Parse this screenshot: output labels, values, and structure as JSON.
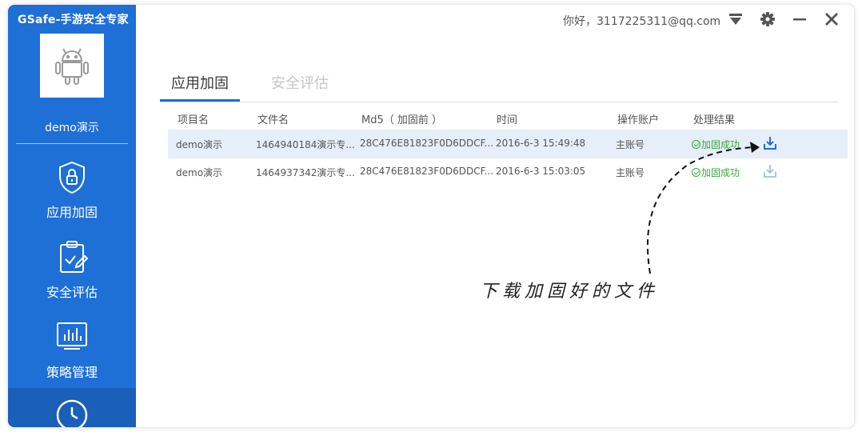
{
  "app": {
    "title": "GSafe-手游安全专家",
    "project_name": "demo演示",
    "greeting": "你好，3117225311@qq.com"
  },
  "sidebar": {
    "items": [
      {
        "label": "应用加固",
        "icon": "shield-lock-icon"
      },
      {
        "label": "安全评估",
        "icon": "clipboard-icon"
      },
      {
        "label": "策略管理",
        "icon": "monitor-chart-icon"
      },
      {
        "label": "",
        "icon": "clock-icon"
      }
    ]
  },
  "tabs": [
    {
      "label": "应用加固",
      "active": true
    },
    {
      "label": "安全评估",
      "active": false
    }
  ],
  "table": {
    "columns": [
      "项目名",
      "文件名",
      "Md5（ 加固前 ）",
      "时间",
      "操作账户",
      "处理结果"
    ],
    "rows": [
      {
        "project": "demo演示",
        "file": "1464940184演示专...",
        "md5": "28C476E81823F0D6DDCF...",
        "time": "2016-6-3 15:49:48",
        "account": "主账号",
        "result": "加固成功"
      },
      {
        "project": "demo演示",
        "file": "1464937342演示专...",
        "md5": "28C476E81823F0D6DDCF...",
        "time": "2016-6-3 15:03:05",
        "account": "主账号",
        "result": "加固成功"
      }
    ]
  },
  "annotation": "下载加固好的文件",
  "colors": {
    "sidebar": "#1e6fd6",
    "accent": "#1e6fd6",
    "success": "#3aa838",
    "row_highlight": "#e6eef9"
  }
}
